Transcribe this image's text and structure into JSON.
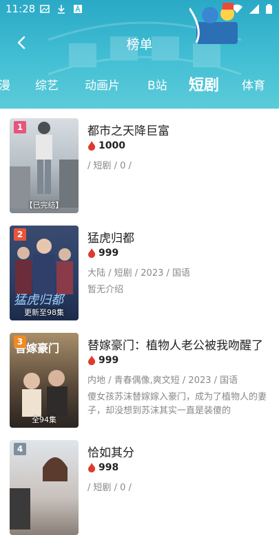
{
  "status_bar": {
    "time": "11:28"
  },
  "header": {
    "title": "榜单"
  },
  "tabs": [
    {
      "label": "漫"
    },
    {
      "label": "综艺"
    },
    {
      "label": "动画片"
    },
    {
      "label": "B站"
    },
    {
      "label": "短剧",
      "active": true
    },
    {
      "label": "体育"
    }
  ],
  "items": [
    {
      "rank": "1",
      "title": "都市之天降巨富",
      "hot": "1000",
      "meta": "/ 短剧 / 0 /",
      "desc": "",
      "badge": "【已完结】",
      "rank_color": "#e8557a"
    },
    {
      "rank": "2",
      "title": "猛虎归都",
      "hot": "999",
      "meta": "大陆 / 短剧 / 2023 / 国语",
      "desc": "暂无介绍",
      "badge": "更新至98集",
      "rank_color": "#e8553a"
    },
    {
      "rank": "3",
      "title": "替嫁豪门：植物人老公被我吻醒了",
      "hot": "999",
      "meta": "内地 / 青春偶像,爽文短 / 2023 / 国语",
      "desc": "傻女孩苏沫替嫁嫁入豪门，成为了植物人的妻子，却没想到苏沫其实一直是装傻的",
      "badge": "全94集",
      "rank_color": "#f08a24"
    },
    {
      "rank": "4",
      "title": "恰如其分",
      "hot": "998",
      "meta": "/ 短剧 / 0 /",
      "desc": "",
      "badge": "",
      "rank_color": "#7f8f9c"
    }
  ],
  "colors": {
    "header": "#43bfd4",
    "fire": "#e03a2e"
  }
}
